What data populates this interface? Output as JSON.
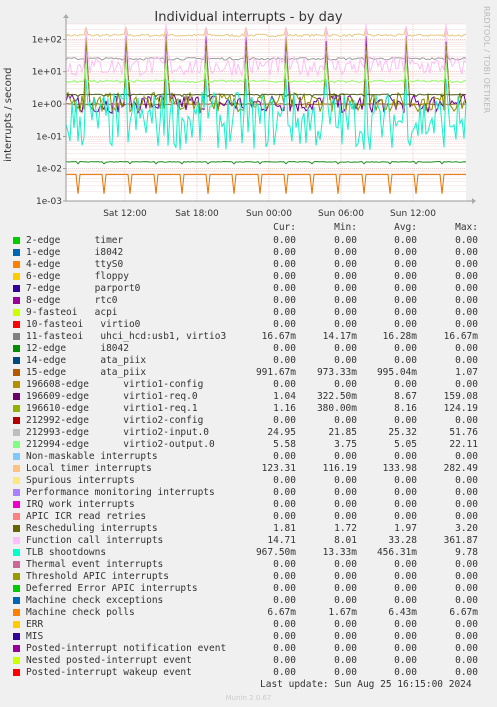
{
  "chart_data": {
    "type": "line",
    "title": "Individual interrupts - by day",
    "ylabel": "interrupts / second",
    "xlabel": "",
    "yscale": "log",
    "ylim": [
      0.001,
      300
    ],
    "yticks": [
      "1e+02",
      "1e+01",
      "1e+00",
      "1e-01",
      "1e-02",
      "1e-03"
    ],
    "xticks": [
      "Sat 12:00",
      "Sat 18:00",
      "Sun 00:00",
      "Sun 06:00",
      "Sun 12:00"
    ],
    "grid": true,
    "series": [
      {
        "name": "Local timer interrupts",
        "color": "#e6c87f",
        "cur": 123.31,
        "min": 116.19,
        "avg": 133.98,
        "max": 282.49
      },
      {
        "name": "15-edge ata_piix",
        "color": "#a05a1e",
        "cur": 0.99167,
        "min": 0.97333,
        "avg": 0.99504,
        "max": 1.07
      },
      {
        "name": "196609-edge virtio1-req.0",
        "color": "#6a0094",
        "cur": 1.04,
        "min": 0.3225,
        "avg": 8.67,
        "max": 159.08
      },
      {
        "name": "196610-edge virtio1-req.1",
        "color": "#8c8c00",
        "cur": 1.16,
        "min": 0.38,
        "avg": 8.16,
        "max": 124.19
      },
      {
        "name": "212993-edge virtio2-input.0",
        "color": "#9a9a9a",
        "cur": 24.95,
        "min": 21.85,
        "avg": 25.32,
        "max": 51.76
      },
      {
        "name": "212994-edge virtio2-output.0",
        "color": "#94ff68",
        "cur": 5.58,
        "min": 3.75,
        "avg": 5.05,
        "max": 22.11
      },
      {
        "name": "Rescheduling interrupts",
        "color": "#4d5b16",
        "cur": 1.81,
        "min": 1.72,
        "avg": 1.97,
        "max": 3.2
      },
      {
        "name": "Function call interrupts",
        "color": "#ffbef5",
        "cur": 14.71,
        "min": 8.01,
        "avg": 33.28,
        "max": 361.87
      },
      {
        "name": "TLB shootdowns",
        "color": "#14f0c8",
        "cur": 0.9675,
        "min": 0.01333,
        "avg": 0.45631,
        "max": 9.78
      },
      {
        "name": "11-fasteoi uhci_hcd:usb1, virtio3",
        "color": "#1e8c1e",
        "cur": 0.01667,
        "min": 0.01417,
        "avg": 0.01628,
        "max": 0.01667
      },
      {
        "name": "Machine check polls",
        "color": "#e67300",
        "cur": 0.00667,
        "min": 0.00167,
        "avg": 0.00643,
        "max": 0.00667
      }
    ]
  },
  "header": {
    "cur": "Cur:",
    "min": "Min:",
    "avg": "Avg:",
    "max": "Max:"
  },
  "rows": [
    {
      "color": "#00cc00",
      "label": "2-edge      timer",
      "cur": "0.00",
      "min": "0.00",
      "avg": "0.00",
      "max": "0.00"
    },
    {
      "color": "#0066b3",
      "label": "1-edge      i8042",
      "cur": "0.00",
      "min": "0.00",
      "avg": "0.00",
      "max": "0.00"
    },
    {
      "color": "#ff8000",
      "label": "4-edge      ttyS0",
      "cur": "0.00",
      "min": "0.00",
      "avg": "0.00",
      "max": "0.00"
    },
    {
      "color": "#ffcc00",
      "label": "6-edge      floppy",
      "cur": "0.00",
      "min": "0.00",
      "avg": "0.00",
      "max": "0.00"
    },
    {
      "color": "#330099",
      "label": "7-edge      parport0",
      "cur": "0.00",
      "min": "0.00",
      "avg": "0.00",
      "max": "0.00"
    },
    {
      "color": "#990099",
      "label": "8-edge      rtc0",
      "cur": "0.00",
      "min": "0.00",
      "avg": "0.00",
      "max": "0.00"
    },
    {
      "color": "#ccff00",
      "label": "9-fasteoi   acpi",
      "cur": "0.00",
      "min": "0.00",
      "avg": "0.00",
      "max": "0.00"
    },
    {
      "color": "#ff0000",
      "label": "10-fasteoi   virtio0",
      "cur": "0.00",
      "min": "0.00",
      "avg": "0.00",
      "max": "0.00"
    },
    {
      "color": "#808080",
      "label": "11-fasteoi   uhci_hcd:usb1, virtio3",
      "cur": "16.67m",
      "min": "14.17m",
      "avg": "16.28m",
      "max": "16.67m"
    },
    {
      "color": "#008f00",
      "label": "12-edge      i8042",
      "cur": "0.00",
      "min": "0.00",
      "avg": "0.00",
      "max": "0.00"
    },
    {
      "color": "#00487d",
      "label": "14-edge      ata_piix",
      "cur": "0.00",
      "min": "0.00",
      "avg": "0.00",
      "max": "0.00"
    },
    {
      "color": "#b35a00",
      "label": "15-edge      ata_piix",
      "cur": "991.67m",
      "min": "973.33m",
      "avg": "995.04m",
      "max": "1.07"
    },
    {
      "color": "#b38f00",
      "label": "196608-edge      virtio1-config",
      "cur": "0.00",
      "min": "0.00",
      "avg": "0.00",
      "max": "0.00"
    },
    {
      "color": "#6b006b",
      "label": "196609-edge      virtio1-req.0",
      "cur": "1.04",
      "min": "322.50m",
      "avg": "8.67",
      "max": "159.08"
    },
    {
      "color": "#8fb300",
      "label": "196610-edge      virtio1-req.1",
      "cur": "1.16",
      "min": "380.00m",
      "avg": "8.16",
      "max": "124.19"
    },
    {
      "color": "#b30000",
      "label": "212992-edge      virtio2-config",
      "cur": "0.00",
      "min": "0.00",
      "avg": "0.00",
      "max": "0.00"
    },
    {
      "color": "#bebebe",
      "label": "212993-edge      virtio2-input.0",
      "cur": "24.95",
      "min": "21.85",
      "avg": "25.32",
      "max": "51.76"
    },
    {
      "color": "#80ff80",
      "label": "212994-edge      virtio2-output.0",
      "cur": "5.58",
      "min": "3.75",
      "avg": "5.05",
      "max": "22.11"
    },
    {
      "color": "#80c9ff",
      "label": "Non-maskable interrupts",
      "cur": "0.00",
      "min": "0.00",
      "avg": "0.00",
      "max": "0.00"
    },
    {
      "color": "#ffc080",
      "label": "Local timer interrupts",
      "cur": "123.31",
      "min": "116.19",
      "avg": "133.98",
      "max": "282.49"
    },
    {
      "color": "#ffe680",
      "label": "Spurious interrupts",
      "cur": "0.00",
      "min": "0.00",
      "avg": "0.00",
      "max": "0.00"
    },
    {
      "color": "#aa80ff",
      "label": "Performance monitoring interrupts",
      "cur": "0.00",
      "min": "0.00",
      "avg": "0.00",
      "max": "0.00"
    },
    {
      "color": "#ee00cc",
      "label": "IRQ work interrupts",
      "cur": "0.00",
      "min": "0.00",
      "avg": "0.00",
      "max": "0.00"
    },
    {
      "color": "#ff8080",
      "label": "APIC ICR read retries",
      "cur": "0.00",
      "min": "0.00",
      "avg": "0.00",
      "max": "0.00"
    },
    {
      "color": "#666600",
      "label": "Rescheduling interrupts",
      "cur": "1.81",
      "min": "1.72",
      "avg": "1.97",
      "max": "3.20"
    },
    {
      "color": "#ffbfff",
      "label": "Function call interrupts",
      "cur": "14.71",
      "min": "8.01",
      "avg": "33.28",
      "max": "361.87"
    },
    {
      "color": "#00ffcc",
      "label": "TLB shootdowns",
      "cur": "967.50m",
      "min": "13.33m",
      "avg": "456.31m",
      "max": "9.78"
    },
    {
      "color": "#cc6699",
      "label": "Thermal event interrupts",
      "cur": "0.00",
      "min": "0.00",
      "avg": "0.00",
      "max": "0.00"
    },
    {
      "color": "#999900",
      "label": "Threshold APIC interrupts",
      "cur": "0.00",
      "min": "0.00",
      "avg": "0.00",
      "max": "0.00"
    },
    {
      "color": "#00cc00",
      "label": "Deferred Error APIC interrupts",
      "cur": "0.00",
      "min": "0.00",
      "avg": "0.00",
      "max": "0.00"
    },
    {
      "color": "#0066b3",
      "label": "Machine check exceptions",
      "cur": "0.00",
      "min": "0.00",
      "avg": "0.00",
      "max": "0.00"
    },
    {
      "color": "#ff8000",
      "label": "Machine check polls",
      "cur": "6.67m",
      "min": "1.67m",
      "avg": "6.43m",
      "max": "6.67m"
    },
    {
      "color": "#ffcc00",
      "label": "ERR",
      "cur": "0.00",
      "min": "0.00",
      "avg": "0.00",
      "max": "0.00"
    },
    {
      "color": "#330099",
      "label": "MIS",
      "cur": "0.00",
      "min": "0.00",
      "avg": "0.00",
      "max": "0.00"
    },
    {
      "color": "#990099",
      "label": "Posted-interrupt notification event",
      "cur": "0.00",
      "min": "0.00",
      "avg": "0.00",
      "max": "0.00"
    },
    {
      "color": "#ccff00",
      "label": "Nested posted-interrupt event",
      "cur": "0.00",
      "min": "0.00",
      "avg": "0.00",
      "max": "0.00"
    },
    {
      "color": "#ff0000",
      "label": "Posted-interrupt wakeup event",
      "cur": "0.00",
      "min": "0.00",
      "avg": "0.00",
      "max": "0.00"
    }
  ],
  "footer": "Last update: Sun Aug 25 16:15:00 2024",
  "side_text": "RRDTOOL / TOBI OETIKER",
  "munin": "Munin 2.0.67"
}
